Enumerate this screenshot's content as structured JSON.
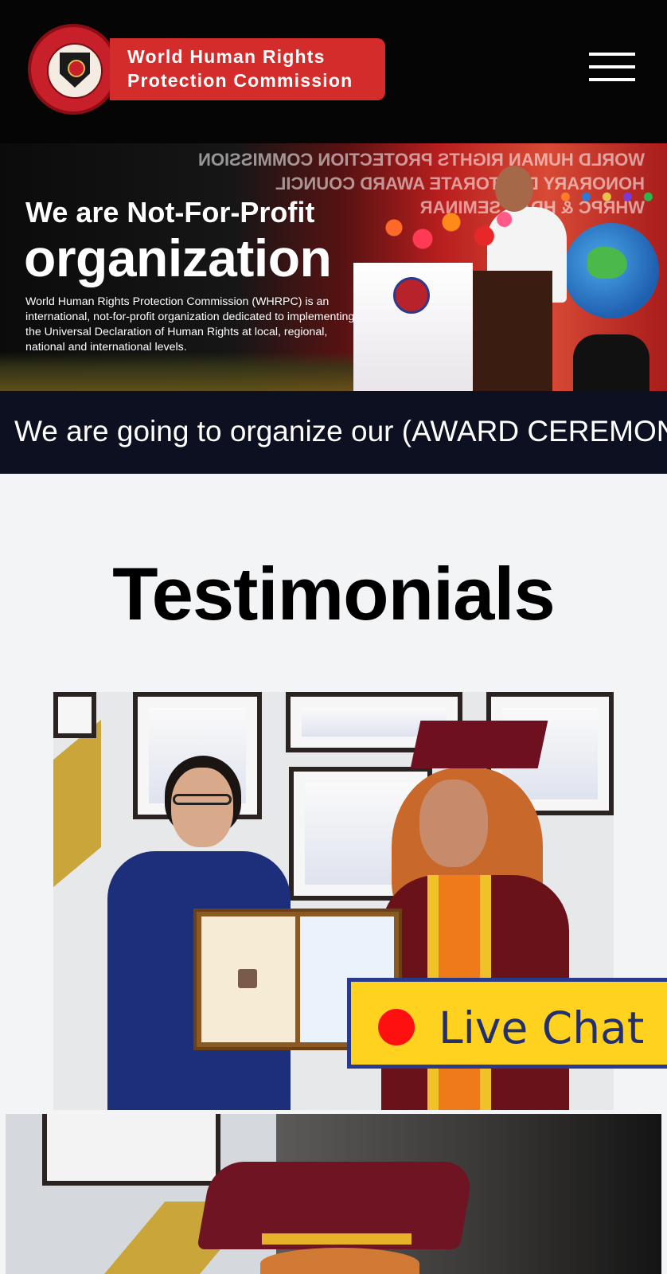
{
  "header": {
    "logo_line1": "World Human Rights",
    "logo_line2": "Protection Commission",
    "menu_icon": "hamburger-menu-icon"
  },
  "hero": {
    "heading": "We are Not-For-Profit",
    "big_heading": "organization",
    "body": "World Human Rights Protection Commission (WHRPC) is an international, not-for-profit organization dedicated to implementing the Universal Declaration of Human Rights at local, regional, national and international levels.",
    "backdrop_lines": [
      "WORLD HUMAN RIGHTS PROTECTION COMMISSION",
      "HONORARY DOCTORATE AWARD COUNCIL",
      "WHRPC & HDAC SEMINAR"
    ]
  },
  "ticker": {
    "text": "We are going to organize our (AWARD CEREMONY"
  },
  "testimonials": {
    "title": "Testimonials"
  },
  "live_chat": {
    "label": "Live Chat",
    "dot_color": "#ff1010",
    "bg_color": "#ffd21f"
  },
  "colors": {
    "header_bg": "#050505",
    "brand_red": "#d42b2b",
    "ticker_bg": "#0c1020",
    "page_bg": "#f3f4f6"
  }
}
